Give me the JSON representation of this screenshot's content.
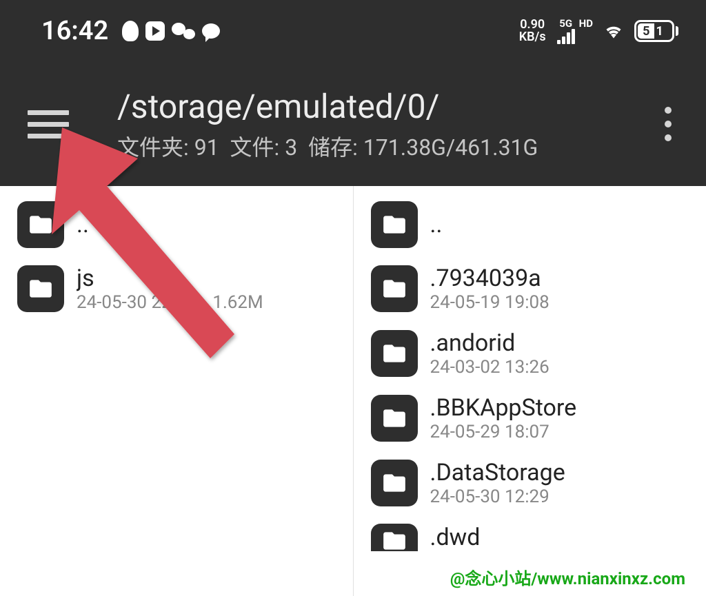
{
  "status_bar": {
    "time": "16:42",
    "speed_value": "0.90",
    "speed_unit": "KB/s",
    "network_type": "5G",
    "network_quality": "HD",
    "battery_level": "51"
  },
  "app_bar": {
    "path": "/storage/emulated/0/",
    "folders_label": "文件夹: ",
    "folders_count": "91",
    "files_label": "文件: ",
    "files_count": "3",
    "storage_label": "储存: ",
    "storage_used": "171.38G",
    "storage_total": "461.31G"
  },
  "left_pane": {
    "parent": "..",
    "items": [
      {
        "name": "js",
        "date": "24-05-30 22:3",
        "size": "1.62M"
      }
    ]
  },
  "right_pane": {
    "parent": "..",
    "items": [
      {
        "name": ".7934039a",
        "date": "24-05-19 19:08"
      },
      {
        "name": ".andorid",
        "date": "24-03-02 13:26"
      },
      {
        "name": ".BBKAppStore",
        "date": "24-05-29 18:07"
      },
      {
        "name": ".DataStorage",
        "date": "24-05-30 12:29"
      },
      {
        "name": ".dwd",
        "date": ""
      }
    ]
  },
  "watermark": "@念心小站/www.nianxinxz.com"
}
